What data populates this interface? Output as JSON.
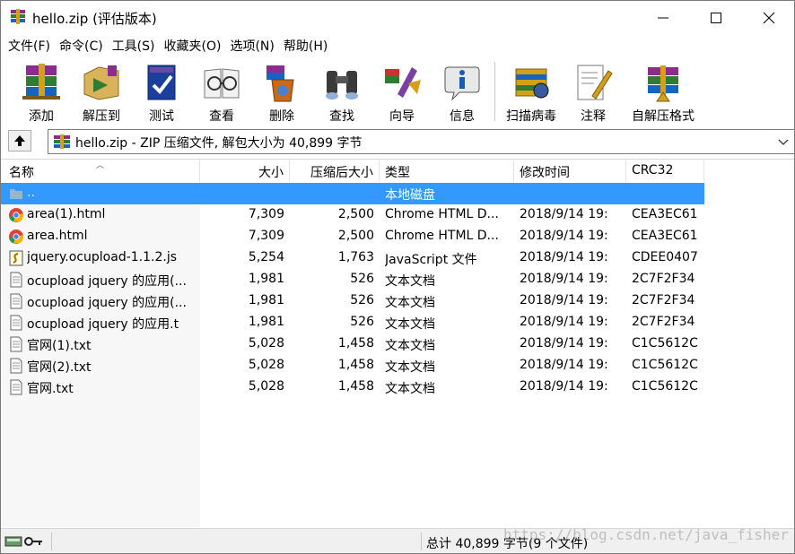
{
  "window": {
    "title": "hello.zip (评估版本)"
  },
  "menu": [
    {
      "label": "文件(F)"
    },
    {
      "label": "命令(C)"
    },
    {
      "label": "工具(S)"
    },
    {
      "label": "收藏夹(O)"
    },
    {
      "label": "选项(N)"
    },
    {
      "label": "帮助(H)"
    }
  ],
  "toolbar": [
    {
      "label": "添加",
      "icon": "add-books-icon"
    },
    {
      "label": "解压到",
      "icon": "extract-to-icon"
    },
    {
      "label": "测试",
      "icon": "test-icon"
    },
    {
      "label": "查看",
      "icon": "view-icon"
    },
    {
      "label": "删除",
      "icon": "delete-icon"
    },
    {
      "label": "查找",
      "icon": "find-binoculars-icon"
    },
    {
      "label": "向导",
      "icon": "wizard-icon"
    },
    {
      "label": "信息",
      "icon": "info-icon"
    },
    {
      "label": "扫描病毒",
      "icon": "virus-scan-icon"
    },
    {
      "label": "注释",
      "icon": "comment-icon"
    },
    {
      "label": "自解压格式",
      "icon": "sfx-icon"
    }
  ],
  "address": {
    "text": "hello.zip - ZIP 压缩文件, 解包大小为 40,899 字节"
  },
  "columns": {
    "name": "名称",
    "size": "大小",
    "packed": "压缩后大小",
    "type": "类型",
    "mtime": "修改时间",
    "crc": "CRC32"
  },
  "parent_row": {
    "name": "..",
    "type": "本地磁盘"
  },
  "files": [
    {
      "icon": "chrome-icon",
      "name": "area(1).html",
      "size": "7,309",
      "packed": "2,500",
      "type": "Chrome HTML D...",
      "mtime": "2018/9/14 19:",
      "crc": "CEA3EC61"
    },
    {
      "icon": "chrome-icon",
      "name": "area.html",
      "size": "7,309",
      "packed": "2,500",
      "type": "Chrome HTML D...",
      "mtime": "2018/9/14 19:",
      "crc": "CEA3EC61"
    },
    {
      "icon": "script-file-icon",
      "name": "jquery.ocupload-1.1.2.js",
      "size": "5,254",
      "packed": "1,763",
      "type": "JavaScript 文件",
      "mtime": "2018/9/14 19:",
      "crc": "CDEE0407"
    },
    {
      "icon": "text-file-icon",
      "name": "ocupload jquery 的应用(...",
      "size": "1,981",
      "packed": "526",
      "type": "文本文档",
      "mtime": "2018/9/14 19:",
      "crc": "2C7F2F34"
    },
    {
      "icon": "text-file-icon",
      "name": "ocupload jquery 的应用(...",
      "size": "1,981",
      "packed": "526",
      "type": "文本文档",
      "mtime": "2018/9/14 19:",
      "crc": "2C7F2F34"
    },
    {
      "icon": "text-file-icon",
      "name": "ocupload jquery 的应用.t",
      "size": "1,981",
      "packed": "526",
      "type": "文本文档",
      "mtime": "2018/9/14 19:",
      "crc": "2C7F2F34"
    },
    {
      "icon": "text-file-icon",
      "name": "官网(1).txt",
      "size": "5,028",
      "packed": "1,458",
      "type": "文本文档",
      "mtime": "2018/9/14 19:",
      "crc": "C1C5612C"
    },
    {
      "icon": "text-file-icon",
      "name": "官网(2).txt",
      "size": "5,028",
      "packed": "1,458",
      "type": "文本文档",
      "mtime": "2018/9/14 19:",
      "crc": "C1C5612C"
    },
    {
      "icon": "text-file-icon",
      "name": "官网.txt",
      "size": "5,028",
      "packed": "1,458",
      "type": "文本文档",
      "mtime": "2018/9/14 19:",
      "crc": "C1C5612C"
    }
  ],
  "status": {
    "text": "总计 40,899 字节(9 个文件)",
    "watermark": "https://blog.csdn.net/java_fisher"
  },
  "colors": {
    "selection": "#3399ff"
  }
}
